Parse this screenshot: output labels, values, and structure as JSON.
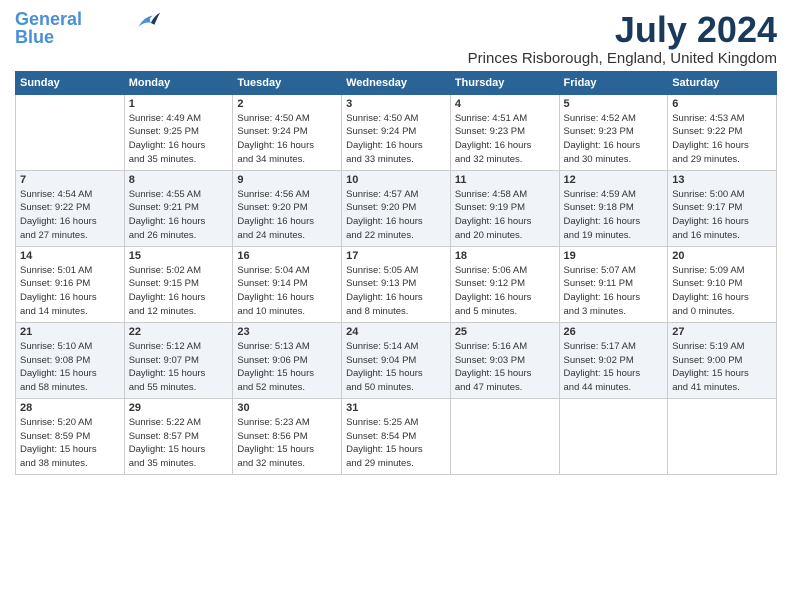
{
  "logo": {
    "line1": "General",
    "line2": "Blue"
  },
  "title": "July 2024",
  "subtitle": "Princes Risborough, England, United Kingdom",
  "days_header": [
    "Sunday",
    "Monday",
    "Tuesday",
    "Wednesday",
    "Thursday",
    "Friday",
    "Saturday"
  ],
  "weeks": [
    [
      {
        "day": "",
        "content": ""
      },
      {
        "day": "1",
        "content": "Sunrise: 4:49 AM\nSunset: 9:25 PM\nDaylight: 16 hours\nand 35 minutes."
      },
      {
        "day": "2",
        "content": "Sunrise: 4:50 AM\nSunset: 9:24 PM\nDaylight: 16 hours\nand 34 minutes."
      },
      {
        "day": "3",
        "content": "Sunrise: 4:50 AM\nSunset: 9:24 PM\nDaylight: 16 hours\nand 33 minutes."
      },
      {
        "day": "4",
        "content": "Sunrise: 4:51 AM\nSunset: 9:23 PM\nDaylight: 16 hours\nand 32 minutes."
      },
      {
        "day": "5",
        "content": "Sunrise: 4:52 AM\nSunset: 9:23 PM\nDaylight: 16 hours\nand 30 minutes."
      },
      {
        "day": "6",
        "content": "Sunrise: 4:53 AM\nSunset: 9:22 PM\nDaylight: 16 hours\nand 29 minutes."
      }
    ],
    [
      {
        "day": "7",
        "content": "Sunrise: 4:54 AM\nSunset: 9:22 PM\nDaylight: 16 hours\nand 27 minutes."
      },
      {
        "day": "8",
        "content": "Sunrise: 4:55 AM\nSunset: 9:21 PM\nDaylight: 16 hours\nand 26 minutes."
      },
      {
        "day": "9",
        "content": "Sunrise: 4:56 AM\nSunset: 9:20 PM\nDaylight: 16 hours\nand 24 minutes."
      },
      {
        "day": "10",
        "content": "Sunrise: 4:57 AM\nSunset: 9:20 PM\nDaylight: 16 hours\nand 22 minutes."
      },
      {
        "day": "11",
        "content": "Sunrise: 4:58 AM\nSunset: 9:19 PM\nDaylight: 16 hours\nand 20 minutes."
      },
      {
        "day": "12",
        "content": "Sunrise: 4:59 AM\nSunset: 9:18 PM\nDaylight: 16 hours\nand 19 minutes."
      },
      {
        "day": "13",
        "content": "Sunrise: 5:00 AM\nSunset: 9:17 PM\nDaylight: 16 hours\nand 16 minutes."
      }
    ],
    [
      {
        "day": "14",
        "content": "Sunrise: 5:01 AM\nSunset: 9:16 PM\nDaylight: 16 hours\nand 14 minutes."
      },
      {
        "day": "15",
        "content": "Sunrise: 5:02 AM\nSunset: 9:15 PM\nDaylight: 16 hours\nand 12 minutes."
      },
      {
        "day": "16",
        "content": "Sunrise: 5:04 AM\nSunset: 9:14 PM\nDaylight: 16 hours\nand 10 minutes."
      },
      {
        "day": "17",
        "content": "Sunrise: 5:05 AM\nSunset: 9:13 PM\nDaylight: 16 hours\nand 8 minutes."
      },
      {
        "day": "18",
        "content": "Sunrise: 5:06 AM\nSunset: 9:12 PM\nDaylight: 16 hours\nand 5 minutes."
      },
      {
        "day": "19",
        "content": "Sunrise: 5:07 AM\nSunset: 9:11 PM\nDaylight: 16 hours\nand 3 minutes."
      },
      {
        "day": "20",
        "content": "Sunrise: 5:09 AM\nSunset: 9:10 PM\nDaylight: 16 hours\nand 0 minutes."
      }
    ],
    [
      {
        "day": "21",
        "content": "Sunrise: 5:10 AM\nSunset: 9:08 PM\nDaylight: 15 hours\nand 58 minutes."
      },
      {
        "day": "22",
        "content": "Sunrise: 5:12 AM\nSunset: 9:07 PM\nDaylight: 15 hours\nand 55 minutes."
      },
      {
        "day": "23",
        "content": "Sunrise: 5:13 AM\nSunset: 9:06 PM\nDaylight: 15 hours\nand 52 minutes."
      },
      {
        "day": "24",
        "content": "Sunrise: 5:14 AM\nSunset: 9:04 PM\nDaylight: 15 hours\nand 50 minutes."
      },
      {
        "day": "25",
        "content": "Sunrise: 5:16 AM\nSunset: 9:03 PM\nDaylight: 15 hours\nand 47 minutes."
      },
      {
        "day": "26",
        "content": "Sunrise: 5:17 AM\nSunset: 9:02 PM\nDaylight: 15 hours\nand 44 minutes."
      },
      {
        "day": "27",
        "content": "Sunrise: 5:19 AM\nSunset: 9:00 PM\nDaylight: 15 hours\nand 41 minutes."
      }
    ],
    [
      {
        "day": "28",
        "content": "Sunrise: 5:20 AM\nSunset: 8:59 PM\nDaylight: 15 hours\nand 38 minutes."
      },
      {
        "day": "29",
        "content": "Sunrise: 5:22 AM\nSunset: 8:57 PM\nDaylight: 15 hours\nand 35 minutes."
      },
      {
        "day": "30",
        "content": "Sunrise: 5:23 AM\nSunset: 8:56 PM\nDaylight: 15 hours\nand 32 minutes."
      },
      {
        "day": "31",
        "content": "Sunrise: 5:25 AM\nSunset: 8:54 PM\nDaylight: 15 hours\nand 29 minutes."
      },
      {
        "day": "",
        "content": ""
      },
      {
        "day": "",
        "content": ""
      },
      {
        "day": "",
        "content": ""
      }
    ]
  ]
}
